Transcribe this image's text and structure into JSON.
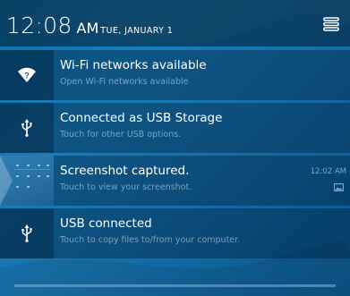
{
  "status": {
    "time": "12:08",
    "ampm": "AM",
    "date": "TUE, JANUARY 1"
  },
  "notifications": [
    {
      "icon": "wifi-question-icon",
      "title": "Wi-Fi networks available",
      "subtitle": "Open Wi-Fi networks available"
    },
    {
      "icon": "usb-icon",
      "title": "Connected as USB Storage",
      "subtitle": "Touch for other USB options."
    },
    {
      "icon": "screenshot-thumbnail",
      "title": "Screenshot captured.",
      "subtitle": "Touch to view your screenshot.",
      "time": "12:02 AM",
      "badge_icon": "gallery-icon"
    },
    {
      "icon": "usb-icon",
      "title": "USB connected",
      "subtitle": "Touch to copy files to/from your computer."
    }
  ],
  "colors": {
    "background": "#1770ab",
    "header": "#0a3a5c",
    "subtitle": "#8fb5d4"
  }
}
